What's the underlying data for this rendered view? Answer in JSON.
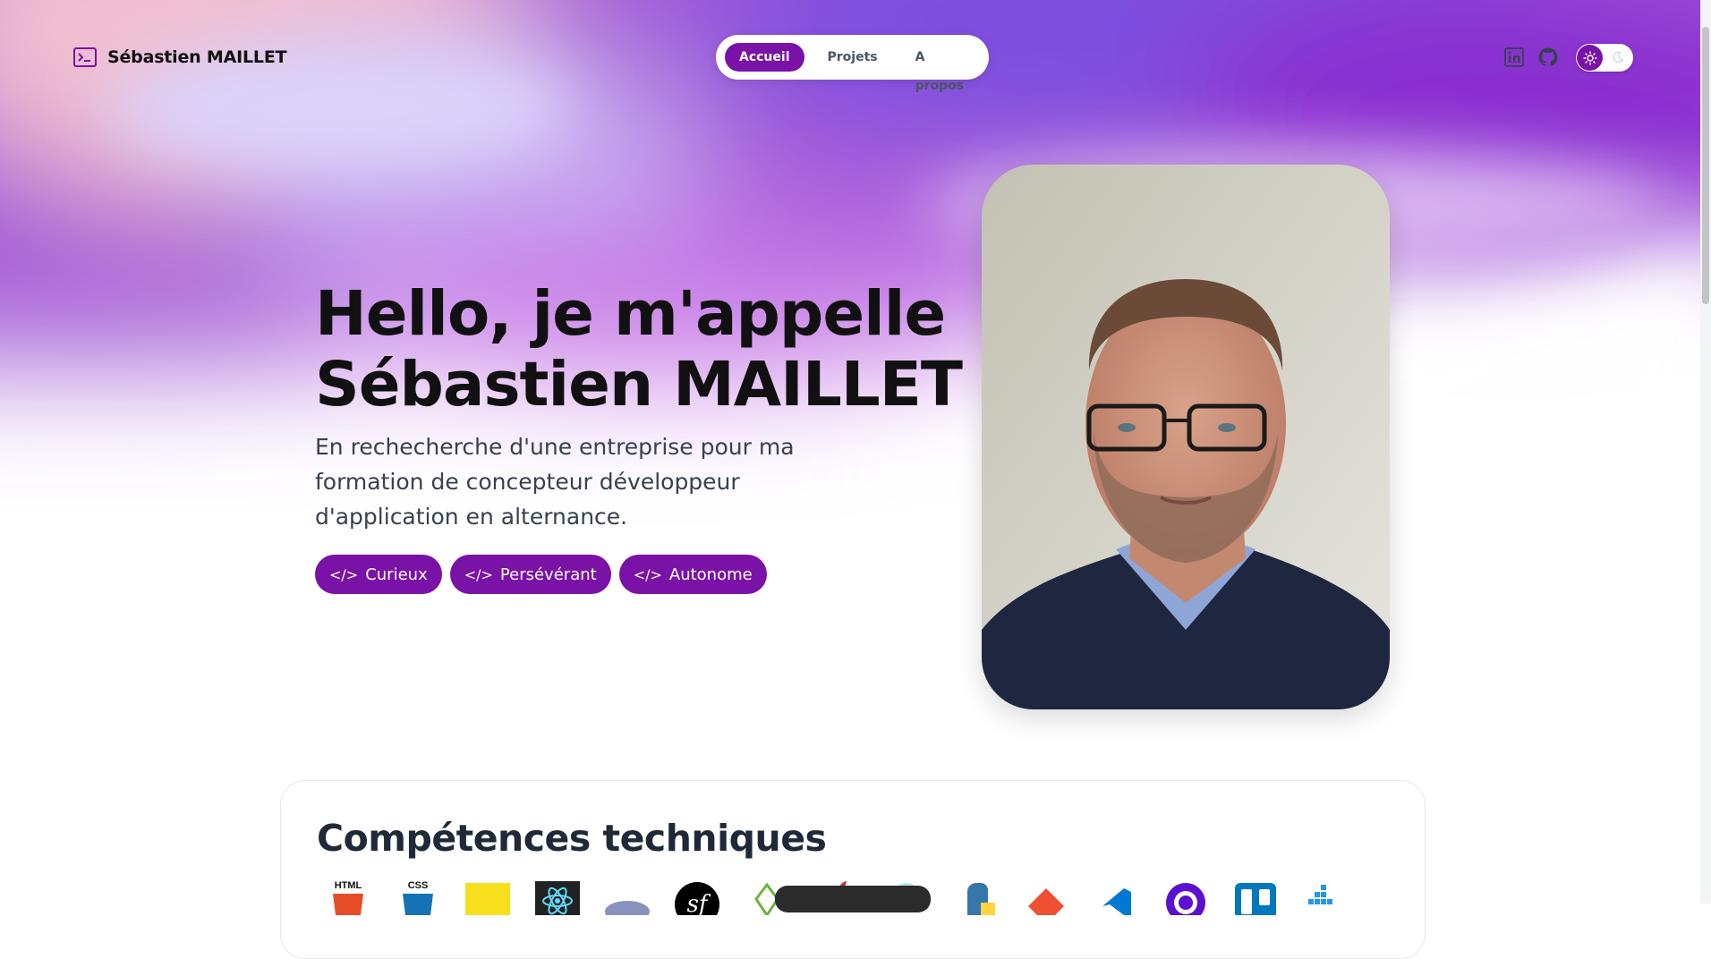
{
  "header": {
    "brand_name": "Sébastien MAILLET",
    "brand_icon": "terminal-icon",
    "nav": [
      {
        "label": "Accueil",
        "active": true
      },
      {
        "label": "Projets",
        "active": false
      },
      {
        "label": "A propos",
        "active": false
      }
    ],
    "social": [
      "linkedin-icon",
      "github-icon"
    ],
    "theme_toggle": {
      "state": "light",
      "icons": [
        "sun-icon",
        "moon-icon"
      ]
    }
  },
  "hero": {
    "title_line1": "Hello, je m'appelle",
    "title_line2": "Sébastien MAILLET",
    "subtitle": "En rechecherche d'une entreprise pour ma formation de concepteur développeur d'application en alternance.",
    "tags": [
      {
        "label": "Curieux",
        "icon": "code-icon"
      },
      {
        "label": "Persévérant",
        "icon": "code-icon"
      },
      {
        "label": "Autonome",
        "icon": "code-icon"
      }
    ],
    "photo": "portrait-photo"
  },
  "skills": {
    "title": "Compétences techniques",
    "icons": [
      "html-icon",
      "css-icon",
      "javascript-icon",
      "react-icon",
      "php-icon",
      "symfony-icon",
      "spring-icon",
      "mysql-icon",
      "bootstrap-icon",
      "python-icon",
      "git-icon",
      "vscode-icon",
      "postman-icon",
      "trello-icon",
      "docker-icon"
    ]
  },
  "colors": {
    "accent": "#7a12a8",
    "text": "#111111",
    "muted": "#374151"
  }
}
